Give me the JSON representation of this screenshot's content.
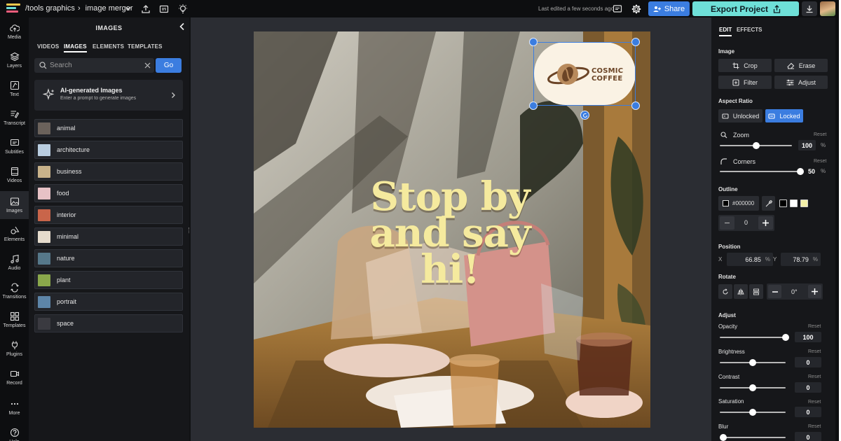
{
  "app": {
    "breadcrumb_folder": "/tools graphics",
    "breadcrumb_sep": "›",
    "project_name": "image merger",
    "last_edited": "Last edited a few seconds ago",
    "share_label": "Share",
    "export_label": "Export Project"
  },
  "rail": {
    "items": [
      {
        "label": "Media",
        "icon": "cloud-upload-icon"
      },
      {
        "label": "Layers",
        "icon": "layers-icon"
      },
      {
        "label": "Text",
        "icon": "text-icon"
      },
      {
        "label": "Transcript",
        "icon": "transcript-icon"
      },
      {
        "label": "Subtitles",
        "icon": "subtitles-icon"
      },
      {
        "label": "Videos",
        "icon": "film-icon"
      },
      {
        "label": "Images",
        "icon": "image-icon"
      },
      {
        "label": "Elements",
        "icon": "shapes-icon"
      },
      {
        "label": "Audio",
        "icon": "music-icon"
      },
      {
        "label": "Transitions",
        "icon": "transitions-icon"
      },
      {
        "label": "Templates",
        "icon": "grid-icon"
      },
      {
        "label": "Plugins",
        "icon": "plug-icon"
      },
      {
        "label": "Record",
        "icon": "camera-icon"
      },
      {
        "label": "More",
        "icon": "more-icon"
      },
      {
        "label": "Help",
        "icon": "help-icon"
      }
    ],
    "active": "Images"
  },
  "panel": {
    "title": "IMAGES",
    "tabs": [
      "VIDEOS",
      "IMAGES",
      "ELEMENTS",
      "TEMPLATES"
    ],
    "active_tab": "IMAGES",
    "search_placeholder": "Search",
    "go_label": "Go",
    "ai_title": "AI-generated Images",
    "ai_subtitle": "Enter a prompt to generate images",
    "categories": [
      {
        "label": "animal",
        "color": "#6b625b"
      },
      {
        "label": "architecture",
        "color": "#b9cde0"
      },
      {
        "label": "business",
        "color": "#c8b28a"
      },
      {
        "label": "food",
        "color": "#e7c2c6"
      },
      {
        "label": "interior",
        "color": "#c9654a"
      },
      {
        "label": "minimal",
        "color": "#e6dccd"
      },
      {
        "label": "nature",
        "color": "#56788a"
      },
      {
        "label": "plant",
        "color": "#8aa84b"
      },
      {
        "label": "portrait",
        "color": "#5d85a8"
      },
      {
        "label": "space",
        "color": "#3a3a40"
      }
    ]
  },
  "canvas": {
    "headline": "Stop by and say hi!",
    "logo_line1": "COSMIC",
    "logo_line2": "COFFEE"
  },
  "props": {
    "tabs": [
      "EDIT",
      "EFFECTS"
    ],
    "active_tab": "EDIT",
    "image_section": "Image",
    "crop": "Crop",
    "erase": "Erase",
    "filter": "Filter",
    "adjust_btn": "Adjust",
    "aspect_section": "Aspect Ratio",
    "unlocked": "Unlocked",
    "locked": "Locked",
    "zoom_label": "Zoom",
    "zoom_value": "100",
    "zoom_fraction": 0.5,
    "corners_label": "Corners",
    "corners_value": "50",
    "corners_fraction": 1.0,
    "reset": "Reset",
    "percent": "%",
    "outline_section": "Outline",
    "outline_color": "#000000",
    "outline_width": "0",
    "position_section": "Position",
    "x_label": "X",
    "x_value": "66.85",
    "y_label": "Y",
    "y_value": "78.79",
    "rotate_section": "Rotate",
    "rotate_value": "0°",
    "adjust_section": "Adjust",
    "opacity_label": "Opacity",
    "opacity_value": "100",
    "opacity_fraction": 1.0,
    "brightness_label": "Brightness",
    "brightness_value": "0",
    "contrast_label": "Contrast",
    "contrast_value": "0",
    "saturation_label": "Saturation",
    "saturation_value": "0",
    "blur_label": "Blur",
    "blur_value": "0"
  },
  "colors": {
    "accent": "#3b7de0",
    "export": "#6ee0d8",
    "headline": "#f5ea9e",
    "swatch_white": "#ffffff",
    "swatch_yellow": "#f3f0a8"
  }
}
